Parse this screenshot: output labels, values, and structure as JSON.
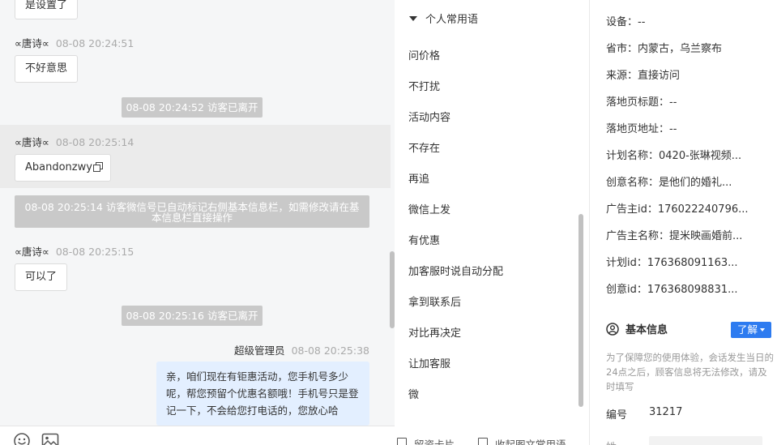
{
  "chat": {
    "top_bubble": "是设置了",
    "messages": [
      {
        "sender": "∝唐诗∝",
        "time": "08-08 20:24:51",
        "text": "不好意思"
      },
      {
        "sender": "∝唐诗∝",
        "time": "08-08 20:25:14",
        "text": "Abandonzwy"
      },
      {
        "sender": "∝唐诗∝",
        "time": "08-08 20:25:15",
        "text": "可以了"
      }
    ],
    "system": [
      "08-08 20:24:52 访客已离开",
      "08-08 20:25:14 访客微信号已自动标记右侧基本信息栏，如需修改请在基本信息栏直接操作",
      "08-08 20:25:16 访客已离开"
    ],
    "outgoing": {
      "sender": "超级管理员",
      "time": "08-08 20:25:38",
      "text": "亲，咱们现在有钜惠活动，您手机号多少呢，帮您预留个优惠名额哦！手机号只是登记一下，不会给您打电话的，您放心哈"
    }
  },
  "phrases": {
    "group_title": "个人常用语",
    "items": [
      "问价格",
      "不打扰",
      "活动内容",
      "不存在",
      "再追",
      "微信上发",
      "有优惠",
      "加客服时说自动分配",
      "拿到联系后",
      "对比再决定",
      "让加客服",
      "微"
    ],
    "bottom_left": "留资卡片",
    "bottom_right": "收起图文常用语"
  },
  "info": {
    "rows": [
      "设备：--",
      "省市：内蒙古，乌兰察布",
      "来源：直接访问",
      "落地页标题：--",
      "落地页地址：--",
      "计划名称：0420-张琳视频...",
      "创意名称：是他们的婚礼...",
      "广告主id：176022240796...",
      "广告主名称：提米映画婚前...",
      "计划id：176368091163...",
      "创意id：176368098831..."
    ],
    "section_title": "基本信息",
    "know_button": "了解",
    "note": "为了保障您的使用体验，会话发生当日的24点之后，顾客信息将无法修改，请及时填写",
    "id_label": "编号",
    "id_value": "31217",
    "next_label": "姓"
  },
  "colors": {
    "accent": "#2d7bf0",
    "outgoing_bubble": "#e3efff",
    "system_bg": "#c9c9c9"
  }
}
